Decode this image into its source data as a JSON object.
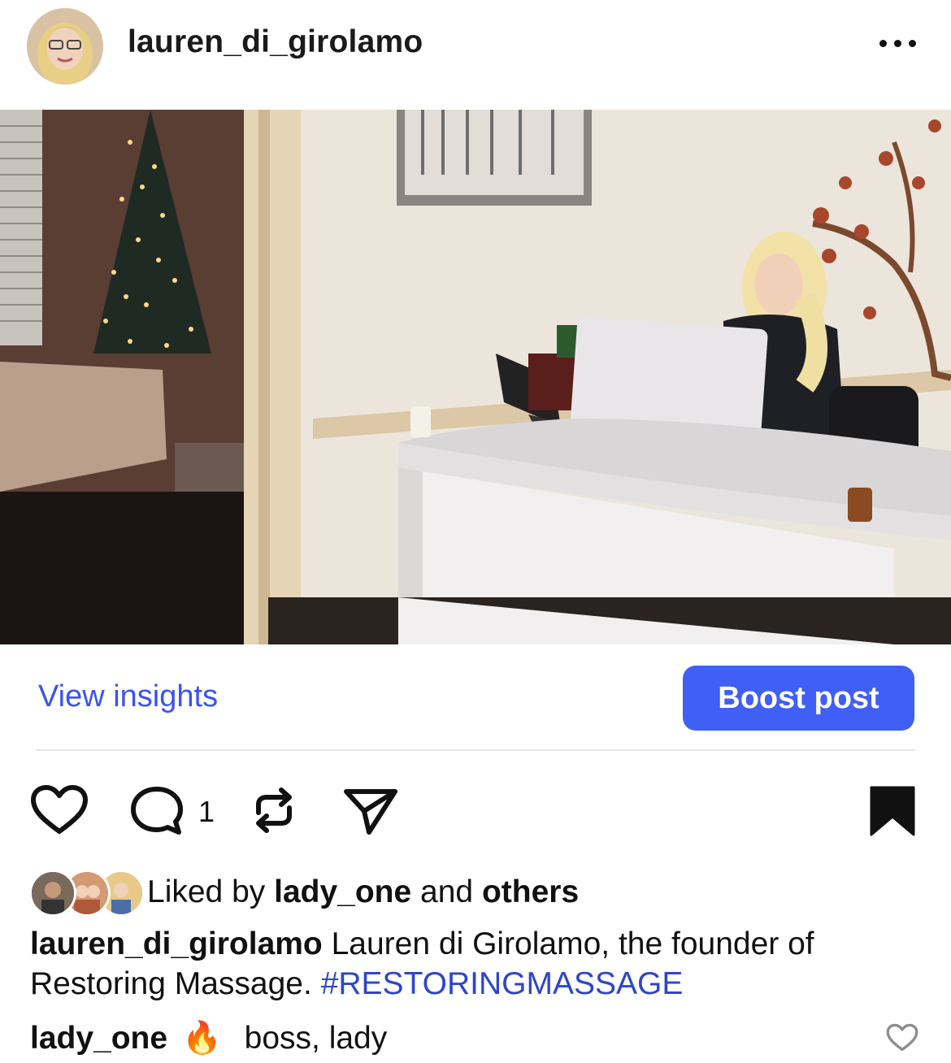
{
  "post": {
    "username": "lauren_di_girolamo",
    "more_icon": "more-horizontal-icon"
  },
  "insights": {
    "view_insights": "View insights",
    "boost_post": "Boost post"
  },
  "actions": {
    "like_icon": "heart-icon",
    "comment_icon": "comment-icon",
    "comment_count": "1",
    "repost_icon": "repost-icon",
    "share_icon": "send-icon",
    "save_icon": "bookmark-filled-icon"
  },
  "likes": {
    "prefix": "Liked by",
    "user": "lady_one",
    "connector": "and",
    "others": "others"
  },
  "caption": {
    "author": "lauren_di_girolamo",
    "text": "Lauren di Girolamo, the founder of Restoring Massage.",
    "hashtag": "#RESTORINGMASSAGE"
  },
  "comment": {
    "author": "lady_one",
    "emoji": "🔥",
    "text": "boss, lady"
  },
  "colors": {
    "accent": "#3f5ff6",
    "link": "#3a53f0"
  }
}
